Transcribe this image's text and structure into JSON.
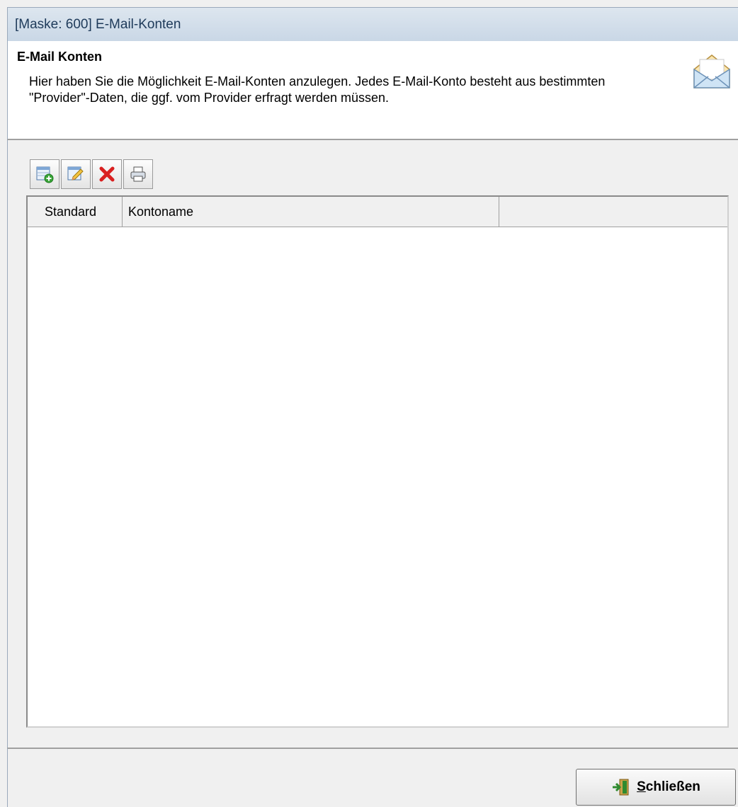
{
  "window": {
    "title": "[Maske: 600] E-Mail-Konten"
  },
  "header": {
    "title": "E-Mail Konten",
    "description": "Hier haben Sie die Möglichkeit E-Mail-Konten anzulegen. Jedes E-Mail-Konto besteht aus bestimmten \"Provider\"-Daten, die ggf. vom Provider erfragt werden müssen.",
    "icon": "email-envelope-icon"
  },
  "toolbar": {
    "buttons": [
      {
        "icon": "add-record-icon"
      },
      {
        "icon": "edit-record-icon"
      },
      {
        "icon": "delete-icon"
      },
      {
        "icon": "print-icon"
      }
    ]
  },
  "table": {
    "columns": [
      "Standard",
      "Kontoname",
      ""
    ],
    "rows": []
  },
  "footer": {
    "close_label": "Schließen",
    "close_icon": "exit-door-icon"
  }
}
